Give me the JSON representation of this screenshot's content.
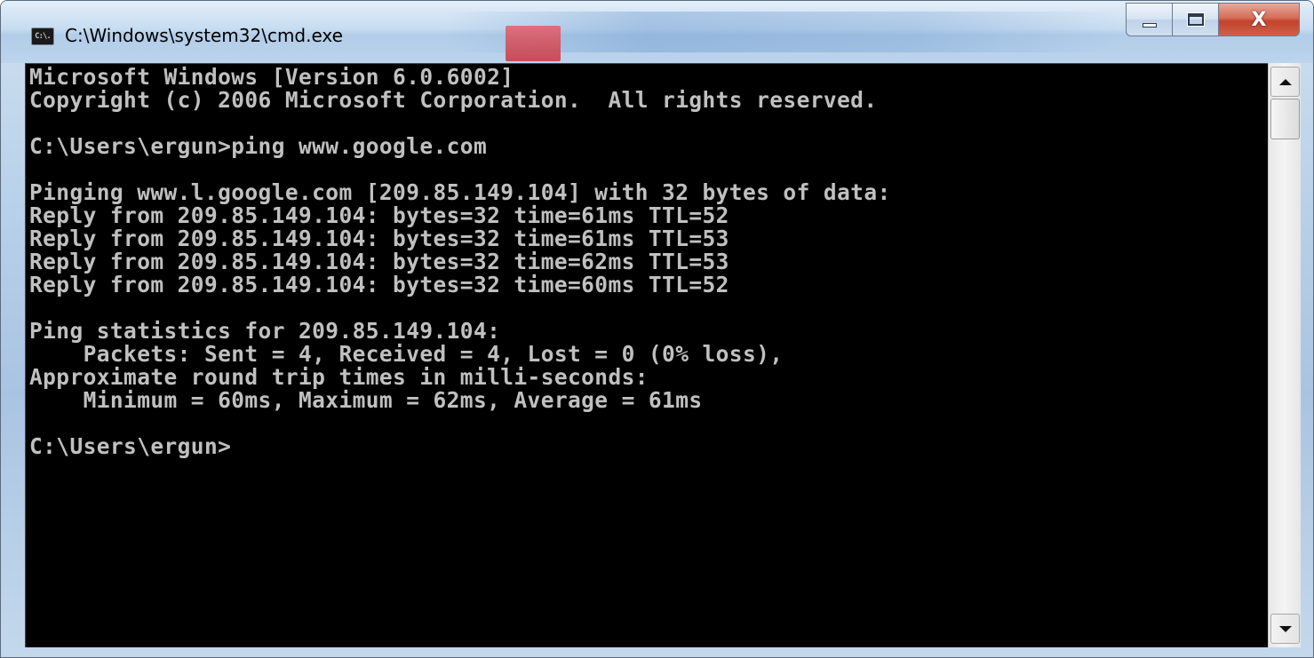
{
  "window": {
    "title": "C:\\Windows\\system32\\cmd.exe",
    "icon": "cmd-icon",
    "icon_text": "C:\\."
  },
  "caption_buttons": {
    "minimize": "minimize-icon",
    "maximize": "maximize-icon",
    "close": "close-icon",
    "close_glyph": "X"
  },
  "console": {
    "lines": [
      "Microsoft Windows [Version 6.0.6002]",
      "Copyright (c) 2006 Microsoft Corporation.  All rights reserved.",
      "",
      "C:\\Users\\ergun>ping www.google.com",
      "",
      "Pinging www.l.google.com [209.85.149.104] with 32 bytes of data:",
      "Reply from 209.85.149.104: bytes=32 time=61ms TTL=52",
      "Reply from 209.85.149.104: bytes=32 time=61ms TTL=53",
      "Reply from 209.85.149.104: bytes=32 time=62ms TTL=53",
      "Reply from 209.85.149.104: bytes=32 time=60ms TTL=52",
      "",
      "Ping statistics for 209.85.149.104:",
      "    Packets: Sent = 4, Received = 4, Lost = 0 (0% loss),",
      "Approximate round trip times in milli-seconds:",
      "    Minimum = 60ms, Maximum = 62ms, Average = 61ms",
      "",
      "C:\\Users\\ergun>"
    ],
    "text_color": "#c0c0c0",
    "background_color": "#000000"
  },
  "scrollbar": {
    "up_icon": "scroll-up-icon",
    "down_icon": "scroll-down-icon"
  }
}
